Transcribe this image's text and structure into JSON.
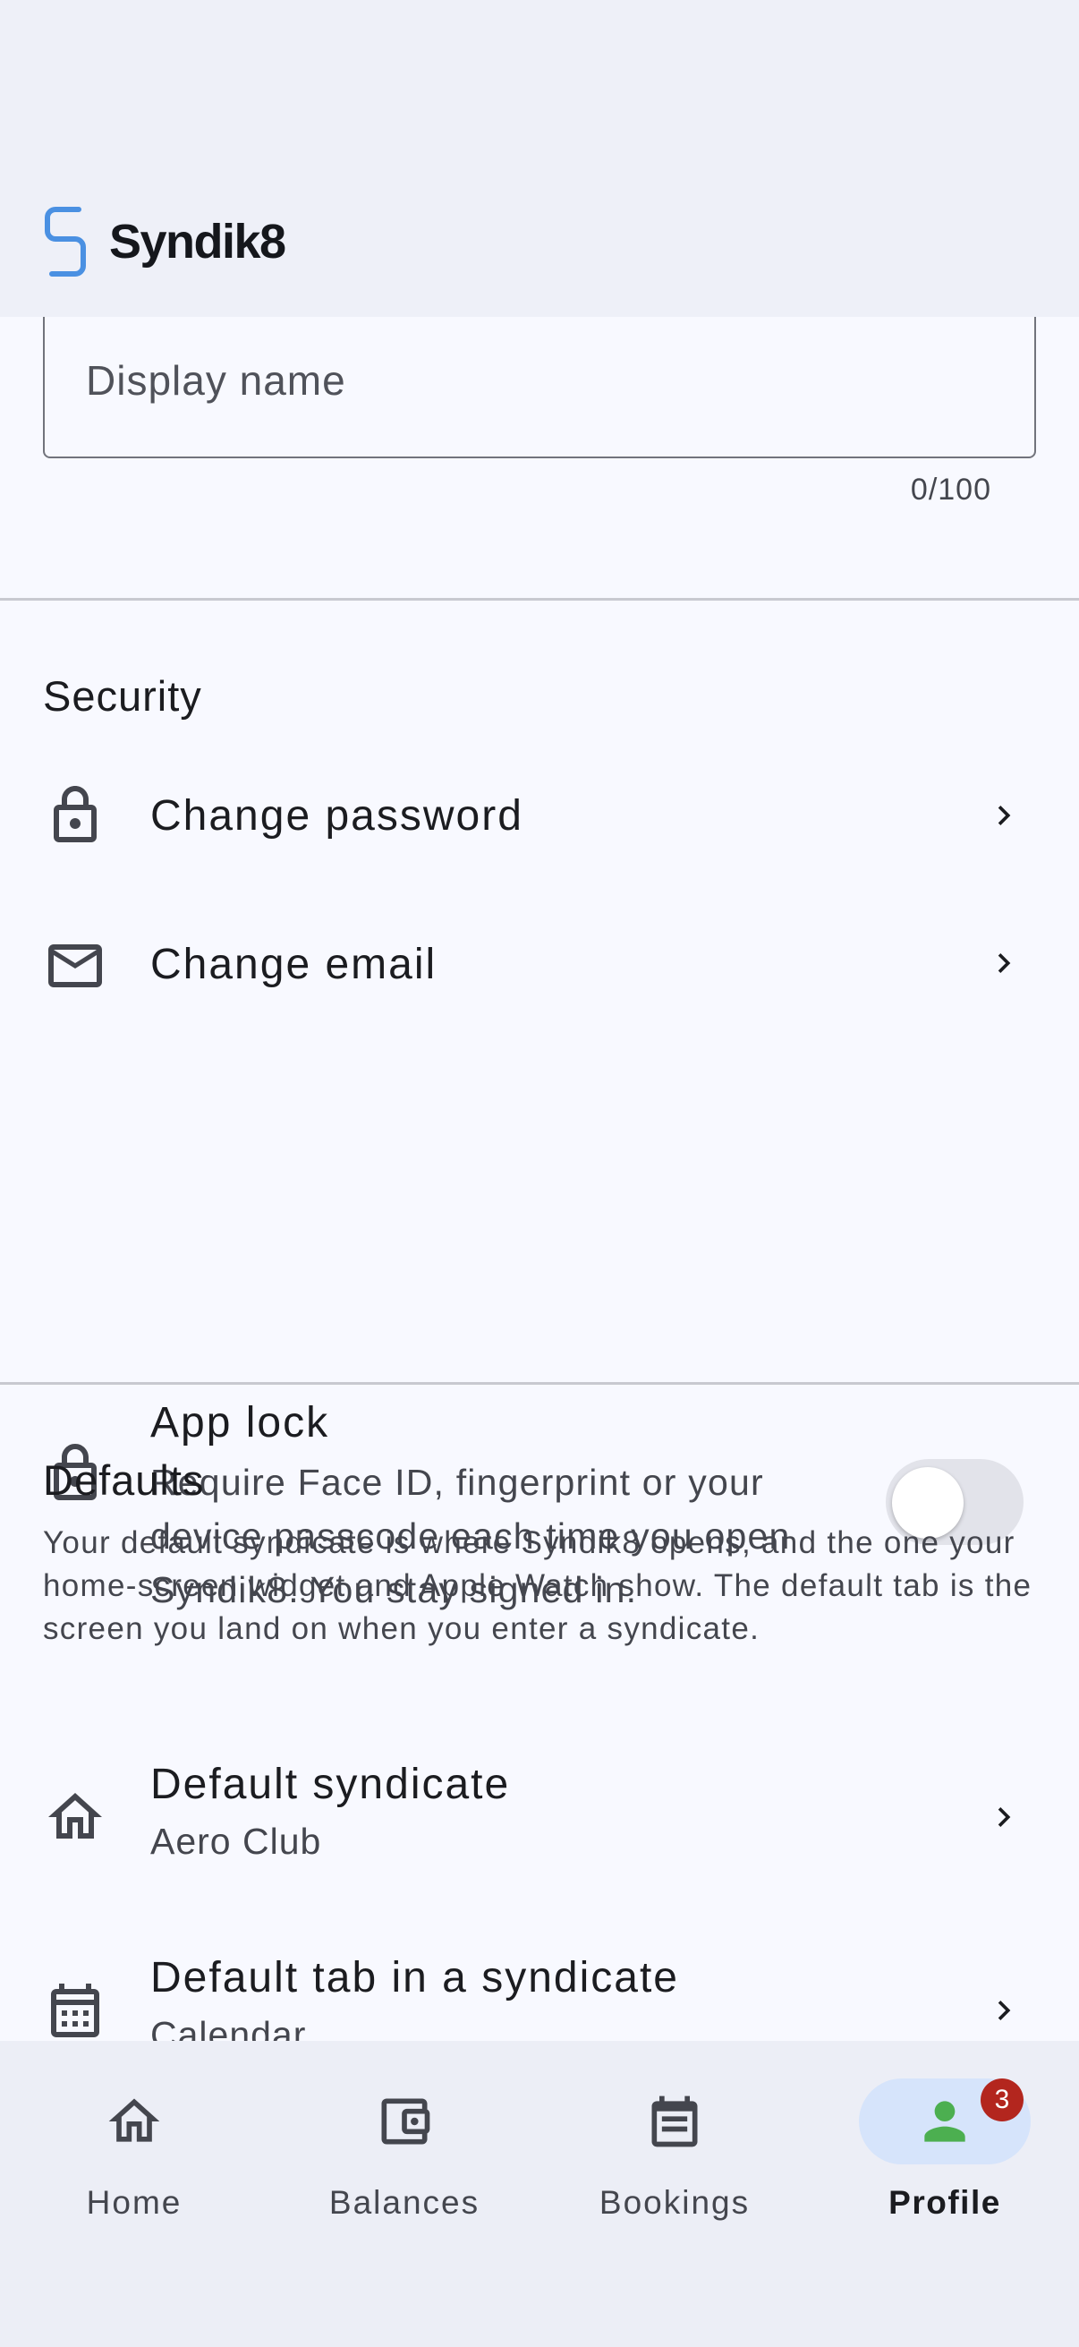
{
  "app": {
    "name": "Syndik8"
  },
  "colors": {
    "accent": "#4a90e2",
    "profile_active": "#4caf50",
    "badge": "#b3261e"
  },
  "display_name": {
    "placeholder": "Display name",
    "value": "",
    "counter": "0/100"
  },
  "security": {
    "title": "Security",
    "change_password": {
      "label": "Change password",
      "icon": "lock-icon"
    },
    "change_email": {
      "label": "Change email",
      "icon": "mail-icon"
    },
    "app_lock": {
      "label": "App lock",
      "description": "Require Face ID, fingerprint or your device passcode each time you open Syndik8. You stay signed in.",
      "enabled": false,
      "icon": "lock-icon"
    }
  },
  "defaults": {
    "title": "Defaults",
    "description": "Your default syndicate is where Syndik8 opens, and the one your home-screen widget and Apple Watch show. The default tab is the screen you land on when you enter a syndicate.",
    "default_syndicate": {
      "label": "Default syndicate",
      "value": "Aero Club",
      "icon": "home-icon"
    },
    "default_tab": {
      "label": "Default tab in a syndicate",
      "value": "Calendar",
      "icon": "calendar-icon"
    }
  },
  "nav": {
    "items": [
      {
        "label": "Home",
        "icon": "home-icon"
      },
      {
        "label": "Balances",
        "icon": "wallet-icon"
      },
      {
        "label": "Bookings",
        "icon": "bookings-icon"
      },
      {
        "label": "Profile",
        "icon": "person-icon",
        "active": true,
        "badge": "3"
      }
    ]
  }
}
